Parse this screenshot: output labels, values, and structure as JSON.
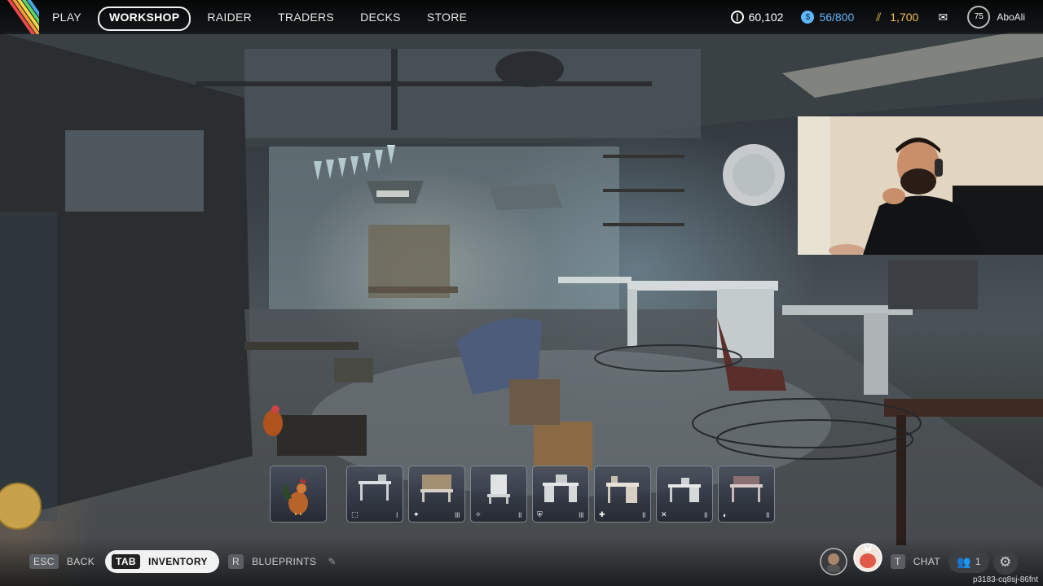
{
  "nav": {
    "items": [
      {
        "label": "PLAY",
        "active": false
      },
      {
        "label": "WORKSHOP",
        "active": true
      },
      {
        "label": "RAIDER",
        "active": false
      },
      {
        "label": "TRADERS",
        "active": false
      },
      {
        "label": "DECKS",
        "active": false
      },
      {
        "label": "STORE",
        "active": false
      }
    ]
  },
  "currency": {
    "coins": "60,102",
    "raider_tokens": "56/800",
    "premium": "1,700"
  },
  "profile": {
    "level": "75",
    "username": "AboAli"
  },
  "tray": {
    "slots": [
      {
        "name": "rooster",
        "icon": "",
        "tier": ""
      },
      {
        "name": "bench-1",
        "icon": "⬚",
        "tier": "I"
      },
      {
        "name": "bench-2",
        "icon": "✦",
        "tier": "III"
      },
      {
        "name": "bench-3",
        "icon": "✧",
        "tier": "II"
      },
      {
        "name": "bench-4",
        "icon": "⛨",
        "tier": "III"
      },
      {
        "name": "bench-5",
        "icon": "✚",
        "tier": "II"
      },
      {
        "name": "bench-6",
        "icon": "✕",
        "tier": "II"
      },
      {
        "name": "bench-7",
        "icon": "◐",
        "tier": "II"
      }
    ]
  },
  "bottom": {
    "back_key": "ESC",
    "back_label": "BACK",
    "inventory_key": "TAB",
    "inventory_label": "INVENTORY",
    "blueprints_key": "R",
    "blueprints_label": "BLUEPRINTS",
    "chat_key": "T",
    "chat_label": "CHAT",
    "party_count": "1",
    "session_id": "p3183-cq8sj-86fnt"
  },
  "colors": {
    "coins": "#ffffff",
    "raider_tokens": "#5db7ff",
    "premium": "#f2c14e",
    "stripes": [
      "#e84a4a",
      "#f29b38",
      "#f2d94a",
      "#5fcf6a",
      "#4aa7e8"
    ]
  }
}
